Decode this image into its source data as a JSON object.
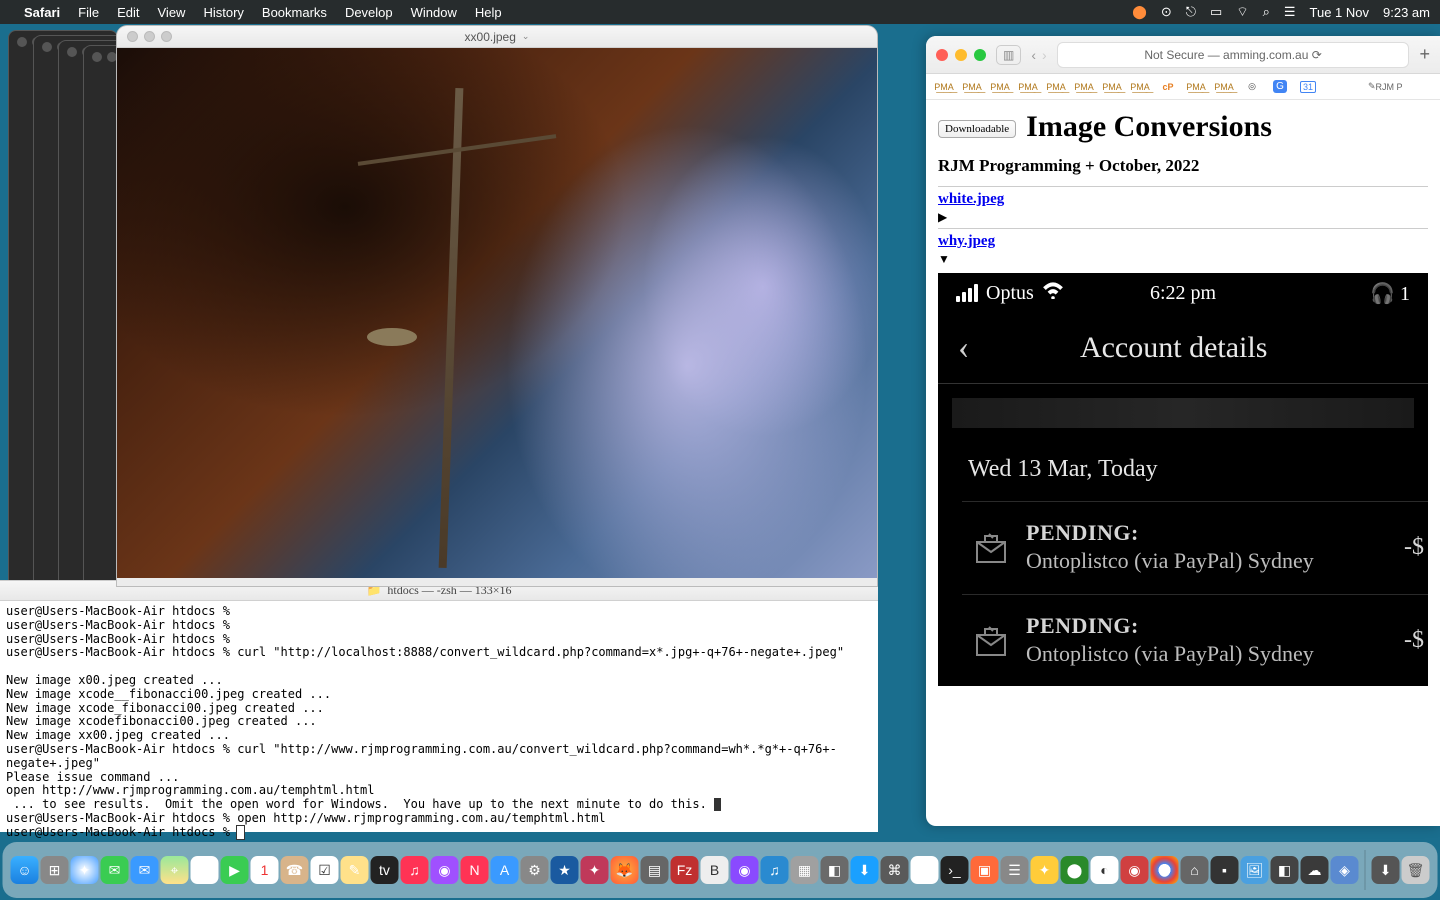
{
  "menubar": {
    "app": "Safari",
    "items": [
      "File",
      "Edit",
      "View",
      "History",
      "Bookmarks",
      "Develop",
      "Window",
      "Help"
    ],
    "right": {
      "date": "Tue 1 Nov",
      "time": "9:23 am"
    }
  },
  "preview": {
    "title": "xx00.jpeg"
  },
  "terminal": {
    "title": "htdocs — -zsh — 133×16",
    "lines": [
      "user@Users-MacBook-Air htdocs % ",
      "user@Users-MacBook-Air htdocs % ",
      "user@Users-MacBook-Air htdocs % ",
      "user@Users-MacBook-Air htdocs % curl \"http://localhost:8888/convert_wildcard.php?command=x*.jpg+-q+76+-negate+.jpeg\"",
      "",
      "New image x00.jpeg created ...",
      "New image xcode__fibonacci00.jpeg created ...",
      "New image xcode_fibonacci00.jpeg created ...",
      "New image xcodefibonacci00.jpeg created ...",
      "New image xx00.jpeg created ...",
      "user@Users-MacBook-Air htdocs % curl \"http://www.rjmprogramming.com.au/convert_wildcard.php?command=wh*.*g*+-q+76+-negate+.jpeg\"",
      "Please issue command ...",
      "open http://www.rjmprogramming.com.au/temphtml.html",
      " ... to see results.  Omit the open word for Windows.  You have up to the next minute to do this. ",
      "user@Users-MacBook-Air htdocs % open http://www.rjmprogramming.com.au/temphtml.html",
      "user@Users-MacBook-Air htdocs % "
    ]
  },
  "safari": {
    "url_display": "Not Secure — amming.com.au",
    "favicons": [
      "PMA",
      "PMA",
      "PMA",
      "PMA",
      "PMA",
      "PMA",
      "PMA",
      "PMA",
      "cP",
      "PMA",
      "PMA",
      "◎",
      "G",
      "31",
      "",
      "RJM P"
    ],
    "page": {
      "button": "Downloadable",
      "h1": "Image Conversions",
      "h3": "RJM Programming + October, 2022",
      "links": [
        "white.jpeg",
        "why.jpeg"
      ],
      "disclosures": [
        "▶",
        "▼"
      ]
    },
    "phone": {
      "carrier": "Optus",
      "time": "6:22 pm",
      "hp": "1",
      "title": "Account details",
      "date": "Wed 13 Mar, Today",
      "rows": [
        {
          "status": "PENDING:",
          "desc": "Ontoplistco (via PayPal) Sydney",
          "amount": "-$"
        },
        {
          "status": "PENDING:",
          "desc": "Ontoplistco (via PayPal) Sydney",
          "amount": "-$"
        }
      ]
    }
  }
}
